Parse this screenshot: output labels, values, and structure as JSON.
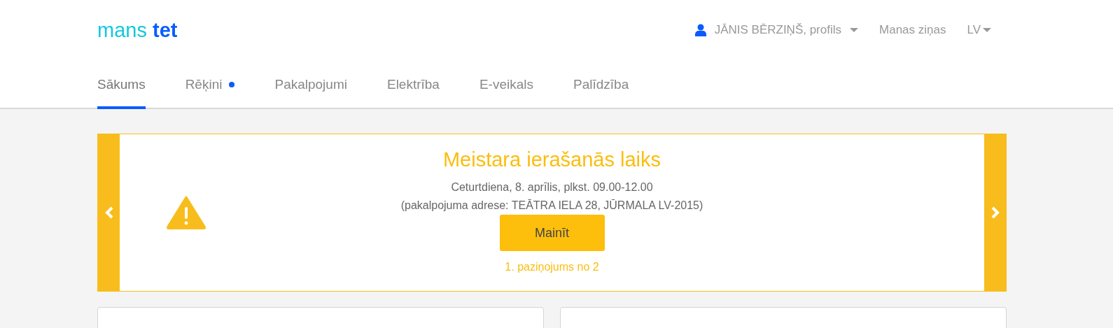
{
  "logo": {
    "word_1": "mans",
    "word_2": "tet"
  },
  "user_menu": {
    "label": "JĀNIS BĒRZIŅŠ, profils",
    "dropdown": true
  },
  "messages_link": "Manas ziņas",
  "language": {
    "label": "LV",
    "dropdown": true
  },
  "tabs": [
    {
      "label": "Sākums",
      "selected": true,
      "notification": false
    },
    {
      "label": "Rēķini",
      "selected": false,
      "notification": true
    },
    {
      "label": "Pakalpojumi",
      "selected": false,
      "notification": false
    },
    {
      "label": "Elektrība",
      "selected": false,
      "notification": false
    },
    {
      "label": "E-veikals",
      "selected": false,
      "notification": false
    },
    {
      "label": "Palīdzība",
      "selected": false,
      "notification": false
    }
  ],
  "notice": {
    "title": "Meistara ierašanās laiks",
    "lines": [
      "Ceturtdiena, 8. aprīlis, plkst. 09.00-12.00",
      "(pakalpojuma adrese: TEĀTRA IELA 28, JŪRMALA LV-2015)"
    ],
    "button": "Mainīt",
    "counter": "1. paziņojums no 2"
  }
}
